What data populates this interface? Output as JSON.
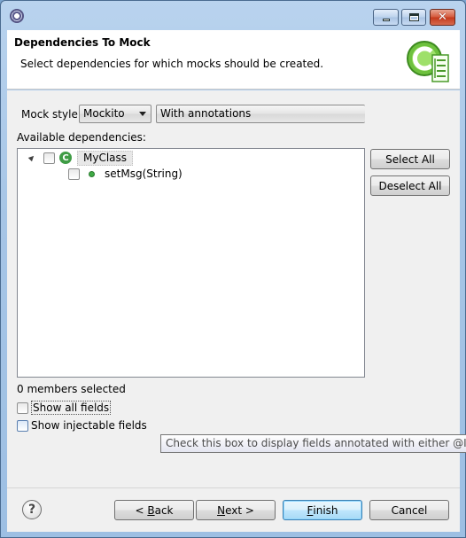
{
  "window": {
    "icon": "eclipse-gear-icon",
    "controls": [
      "minimize-icon",
      "maximize-icon",
      "close-icon"
    ]
  },
  "header": {
    "title": "Dependencies To Mock",
    "description": "Select dependencies for which mocks should be created.",
    "logo_icon": "class-wizard-logo-icon"
  },
  "form": {
    "mock_style_label": "Mock style:",
    "mock_style_value": "Mockito",
    "annotation_value": "With annotations",
    "available_label": "Available dependencies:"
  },
  "tree": {
    "class_icon_glyph": "C",
    "class_label": "MyClass",
    "method_label": "setMsg(String)"
  },
  "side_buttons": {
    "select_all": "Select All",
    "deselect_all": "Deselect All"
  },
  "status": {
    "members_selected": "0 members selected"
  },
  "options": {
    "show_all_fields": "Show all fields",
    "show_injectable_fields": "Show injectable fields"
  },
  "tooltip": {
    "text": "Check this box to display fields annotated with either @Inject, @"
  },
  "footer": {
    "help_glyph": "?",
    "back_prefix": "< ",
    "back_mnemonic": "B",
    "back_rest": "ack",
    "next_mnemonic": "N",
    "next_rest": "ext >",
    "finish_mnemonic": "F",
    "finish_rest": "inish",
    "cancel": "Cancel"
  },
  "colors": {
    "title_bar": "#a6c5e6",
    "class_icon": "#3f9c45",
    "dialog_bg": "#f0f0f0"
  }
}
